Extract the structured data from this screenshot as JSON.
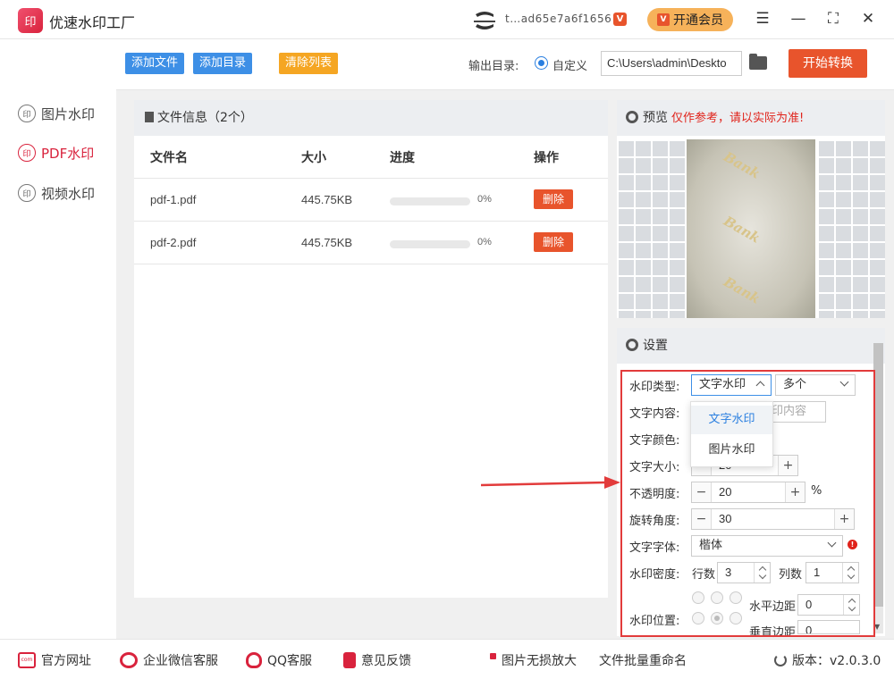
{
  "app": {
    "title": "优速水印工厂",
    "logo_text": "印",
    "user_id": "t…ad65e7a6f1656",
    "vip_button": "开通会员"
  },
  "window_controls": {
    "menu": "☰",
    "minimize": "—",
    "maximize": "⛶",
    "close": "✕"
  },
  "sidebar": {
    "items": [
      {
        "label": "图片水印",
        "icon": "印",
        "active": false
      },
      {
        "label": "PDF水印",
        "icon": "印",
        "active": true
      },
      {
        "label": "视频水印",
        "icon": "印",
        "active": false
      }
    ]
  },
  "toolbar": {
    "add_file": "添加文件",
    "add_dir": "添加目录",
    "clear_list": "清除列表",
    "output_label": "输出目录:",
    "custom_label": "自定义",
    "output_path": "C:\\Users\\admin\\Deskto",
    "start": "开始转换"
  },
  "file_panel": {
    "header": "文件信息（2个）",
    "columns": [
      "文件名",
      "大小",
      "进度",
      "操作"
    ],
    "rows": [
      {
        "name": "pdf-1.pdf",
        "size": "445.75KB",
        "progress": 0,
        "progress_label": "0%",
        "action": "删除"
      },
      {
        "name": "pdf-2.pdf",
        "size": "445.75KB",
        "progress": 0,
        "progress_label": "0%",
        "action": "删除"
      }
    ]
  },
  "preview": {
    "title": "预览",
    "warning": "仅作参考，请以实际为准!",
    "watermark_text": "Bank"
  },
  "settings": {
    "title": "设置",
    "type_label": "水印类型:",
    "type_value": "文字水印",
    "count_value": "多个",
    "content_label": "文字内容:",
    "content_placeholder": "印内容",
    "color_label": "文字颜色:",
    "size_label": "文字大小:",
    "size_value": "20",
    "opacity_label": "不透明度:",
    "opacity_value": "20",
    "opacity_unit": "%",
    "rotation_label": "旋转角度:",
    "rotation_value": "30",
    "font_label": "文字字体:",
    "font_value": "楷体",
    "density_label": "水印密度:",
    "rows_label": "行数",
    "rows_value": "3",
    "cols_label": "列数",
    "cols_value": "1",
    "position_label": "水印位置:",
    "hmargin_label": "水平边距",
    "hmargin_value": "0",
    "vmargin_label": "垂直边距",
    "vmargin_value": "0",
    "dropdown_options": [
      "文字水印",
      "图片水印"
    ]
  },
  "footer": {
    "website": "官方网址",
    "wechat": "企业微信客服",
    "qq": "QQ客服",
    "feedback": "意见反馈",
    "lossless": "图片无损放大",
    "rename": "文件批量重命名",
    "version_label": "版本：v2.0.3.0"
  },
  "colors": {
    "accent_blue": "#3d8fe6",
    "accent_red": "#e8542c",
    "active_nav": "#d9233d",
    "highlight_box": "#e23b3b"
  }
}
